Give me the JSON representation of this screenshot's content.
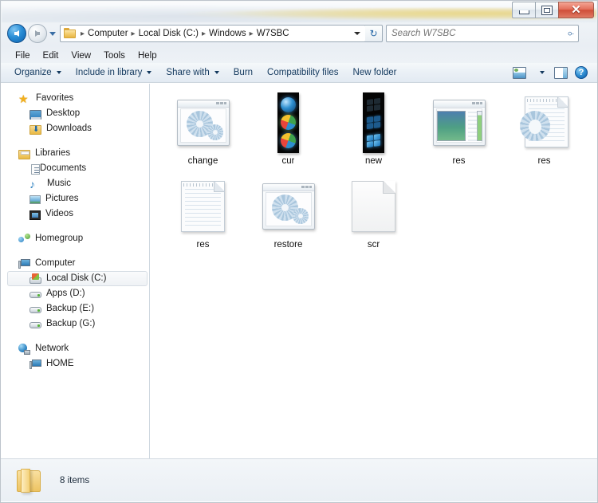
{
  "window": {
    "buttons": {
      "minimize": "Minimize",
      "maximize": "Maximize",
      "close": "Close",
      "close_glyph": "✕"
    }
  },
  "addressbar": {
    "back_label": "Back",
    "forward_label": "Forward",
    "recent_label": "Recent pages",
    "breadcrumbs": [
      "Computer",
      "Local Disk (C:)",
      "Windows",
      "W7SBC"
    ],
    "separator": "▸",
    "dropdown_label": "Previous locations",
    "refresh_label": "Refresh",
    "refresh_glyph": "↻"
  },
  "search": {
    "placeholder": "Search W7SBC",
    "value": "",
    "icon_glyph": "⌕"
  },
  "menubar": {
    "items": [
      "File",
      "Edit",
      "View",
      "Tools",
      "Help"
    ]
  },
  "toolbar": {
    "items": [
      {
        "label": "Organize",
        "has_caret": true
      },
      {
        "label": "Include in library",
        "has_caret": true
      },
      {
        "label": "Share with",
        "has_caret": true
      },
      {
        "label": "Burn",
        "has_caret": false
      },
      {
        "label": "Compatibility files",
        "has_caret": false
      },
      {
        "label": "New folder",
        "has_caret": false
      }
    ],
    "view_button_label": "Change your view",
    "view_caret_label": "More options",
    "preview_pane_label": "Show the preview pane",
    "help_label": "Get help",
    "help_glyph": "?"
  },
  "sidebar": {
    "groups": [
      {
        "header": {
          "label": "Favorites",
          "icon": "star-icon",
          "icon_class": "ico-star",
          "glyph": "★"
        },
        "items": [
          {
            "label": "Desktop",
            "icon": "desktop-icon",
            "icon_class": "ico-desktop"
          },
          {
            "label": "Downloads",
            "icon": "downloads-icon",
            "icon_class": "ico-dl-folder"
          }
        ]
      },
      {
        "header": {
          "label": "Libraries",
          "icon": "libraries-icon",
          "icon_class": "ico-library"
        },
        "items": [
          {
            "label": "Documents",
            "icon": "documents-icon",
            "icon_class": "ico-doc"
          },
          {
            "label": "Music",
            "icon": "music-icon",
            "icon_class": "ico-music",
            "glyph": "♪"
          },
          {
            "label": "Pictures",
            "icon": "pictures-icon",
            "icon_class": "ico-picture"
          },
          {
            "label": "Videos",
            "icon": "videos-icon",
            "icon_class": "ico-video"
          }
        ]
      },
      {
        "header": {
          "label": "Homegroup",
          "icon": "homegroup-icon",
          "icon_class": "ico-homegroup"
        },
        "items": []
      },
      {
        "header": {
          "label": "Computer",
          "icon": "computer-icon",
          "icon_class": "ico-computer"
        },
        "items": [
          {
            "label": "Local Disk (C:)",
            "icon": "system-drive-icon",
            "icon_class": "ico-hdd-sys",
            "selected": true
          },
          {
            "label": "Apps (D:)",
            "icon": "drive-icon",
            "icon_class": "ico-hdd"
          },
          {
            "label": "Backup (E:)",
            "icon": "drive-icon",
            "icon_class": "ico-hdd"
          },
          {
            "label": "Backup (G:)",
            "icon": "drive-icon",
            "icon_class": "ico-hdd"
          }
        ]
      },
      {
        "header": {
          "label": "Network",
          "icon": "network-icon",
          "icon_class": "ico-network"
        },
        "items": [
          {
            "label": "HOME",
            "icon": "computer-node-icon",
            "icon_class": "ico-pc"
          }
        ]
      }
    ]
  },
  "files": [
    {
      "name": "change",
      "art": "window-gears"
    },
    {
      "name": "cur",
      "art": "orb-strip"
    },
    {
      "name": "new",
      "art": "flag-strip"
    },
    {
      "name": "res",
      "art": "dialog-preview"
    },
    {
      "name": "res",
      "art": "doc-gear"
    },
    {
      "name": "res",
      "art": "lined-paper"
    },
    {
      "name": "restore",
      "art": "window-gears"
    },
    {
      "name": "scr",
      "art": "blank-doc"
    }
  ],
  "statusbar": {
    "item_count_text": "8 items",
    "folder_icon": "folder-icon"
  },
  "colors": {
    "accent": "#13395e",
    "close_button": "#cf4e38",
    "selection": "#eff2f5",
    "frame_border": "#6d7d8c"
  }
}
